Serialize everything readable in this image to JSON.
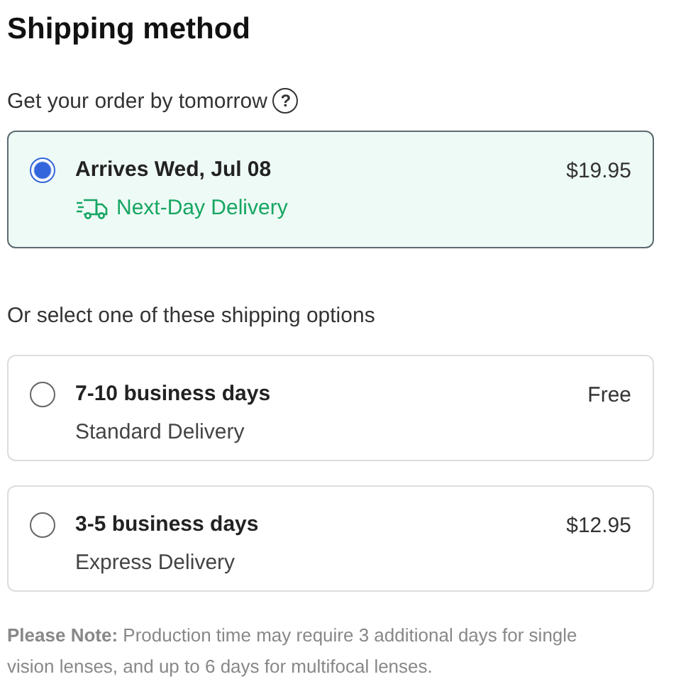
{
  "title": "Shipping method",
  "fast": {
    "prompt": "Get your order by tomorrow",
    "help": "?",
    "options": [
      {
        "highlighted": true,
        "selected": true,
        "title": "Arrives Wed, Jul 08",
        "subtitle": "Next-Day Delivery",
        "price": "$19.95"
      }
    ]
  },
  "other": {
    "prompt": "Or select one of these shipping options",
    "options": [
      {
        "highlighted": false,
        "selected": false,
        "title": "7-10 business days",
        "subtitle": "Standard Delivery",
        "price": "Free"
      },
      {
        "highlighted": false,
        "selected": false,
        "title": "3-5 business days",
        "subtitle": "Express Delivery",
        "price": "$12.95"
      }
    ]
  },
  "note": "**Please Note:** Production time may require 3 additional days for single vision lenses, and up to 6 days for multifocal lenses."
}
